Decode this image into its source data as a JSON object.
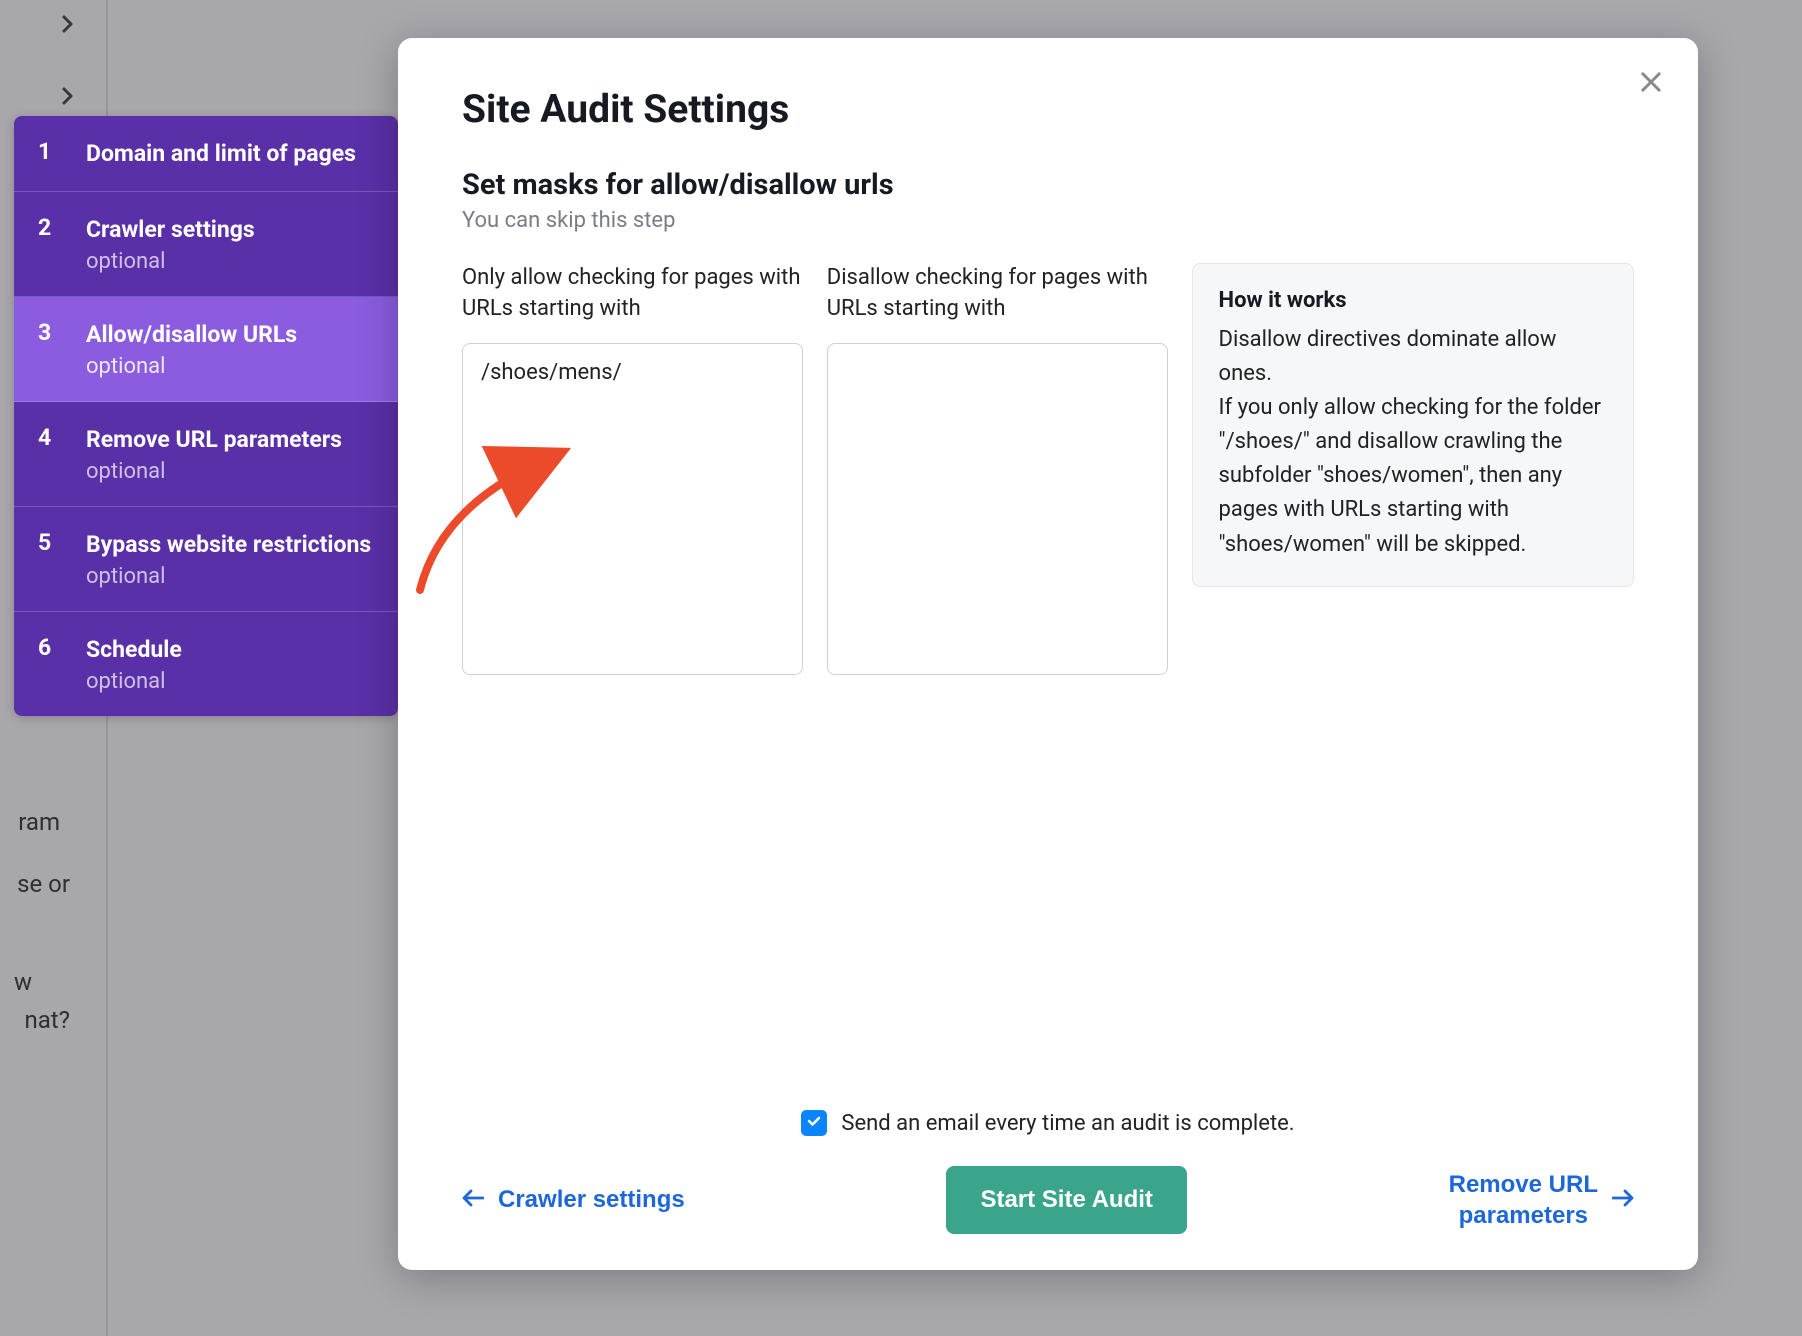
{
  "bg_text": {
    "t1": "ram",
    "t2": "se or",
    "t3": "w",
    "t4": "nat?"
  },
  "sidebar": {
    "steps": [
      {
        "num": "1",
        "title": "Domain and limit of pages",
        "sub": ""
      },
      {
        "num": "2",
        "title": "Crawler settings",
        "sub": "optional"
      },
      {
        "num": "3",
        "title": "Allow/disallow URLs",
        "sub": "optional"
      },
      {
        "num": "4",
        "title": "Remove URL parameters",
        "sub": "optional"
      },
      {
        "num": "5",
        "title": "Bypass website restrictions",
        "sub": "optional"
      },
      {
        "num": "6",
        "title": "Schedule",
        "sub": "optional"
      }
    ]
  },
  "modal": {
    "title": "Site Audit Settings",
    "subtitle_h2": "Set masks for allow/disallow urls",
    "subtitle_hint": "You can skip this step",
    "allow_label": "Only allow checking for pages with URLs starting with",
    "disallow_label": "Disallow checking for pages with URLs starting with",
    "allow_value": "/shoes/mens/",
    "disallow_value": "",
    "info_title": "How it works",
    "info_text": "Disallow directives dominate allow ones.\nIf you only allow checking for the folder \"/shoes/\" and disallow crawling the subfolder \"shoes/women\", then any pages with URLs starting with \"shoes/women\" will be skipped."
  },
  "footer": {
    "email_label": "Send an email every time an audit is complete.",
    "back_label": "Crawler settings",
    "start_label": "Start Site Audit",
    "next_label": "Remove URL parameters"
  }
}
